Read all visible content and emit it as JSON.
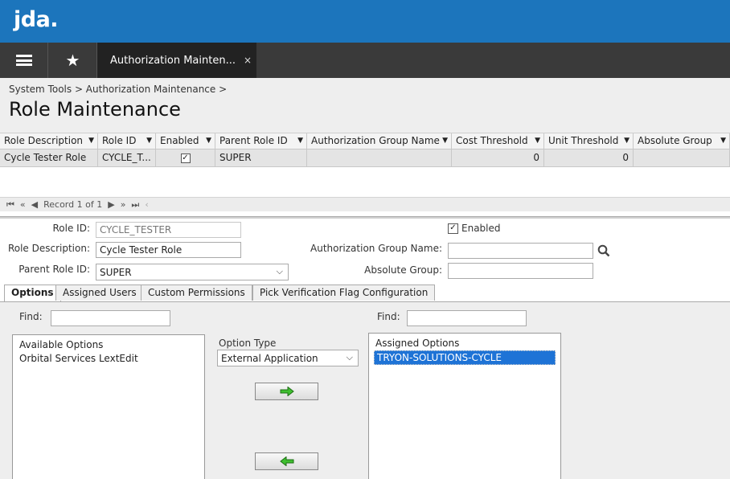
{
  "app": {
    "logo": "jda."
  },
  "nav": {
    "tab_label": "Authorization Mainten...",
    "tab_close": "×"
  },
  "breadcrumb": "System Tools > Authorization Maintenance >",
  "page_title": "Role Maintenance",
  "grid": {
    "columns": [
      "Role Description",
      "Role ID",
      "Enabled",
      "Parent Role ID",
      "Authorization Group Name",
      "Cost Threshold",
      "Unit Threshold",
      "Absolute Group"
    ],
    "row": {
      "role_description": "Cycle Tester Role",
      "role_id": "CYCLE_T...",
      "enabled_mark": "✓",
      "parent_role_id": "SUPER",
      "auth_group": "",
      "cost_threshold": "0",
      "unit_threshold": "0",
      "absolute_group": ""
    }
  },
  "pager": {
    "record_text": "Record 1 of 1"
  },
  "form": {
    "role_id_label": "Role ID:",
    "role_id_value": "CYCLE_TESTER",
    "role_desc_label": "Role Description:",
    "role_desc_value": "Cycle Tester Role",
    "parent_role_label": "Parent Role ID:",
    "parent_role_value": "SUPER",
    "enabled_label": "Enabled",
    "enabled_mark": "✓",
    "auth_group_label": "Authorization Group Name:",
    "auth_group_value": "",
    "absolute_group_label": "Absolute Group:",
    "absolute_group_value": ""
  },
  "tabs": [
    "Options",
    "Assigned Users",
    "Custom Permissions",
    "Pick Verification Flag Configuration"
  ],
  "options": {
    "find_label": "Find:",
    "available_header": "Available Options",
    "available_items": [
      "Orbital Services LextEdit"
    ],
    "option_type_label": "Option Type",
    "option_type_value": "External Application",
    "assigned_header": "Assigned Options",
    "assigned_items": [
      "TRYON-SOLUTIONS-CYCLE"
    ]
  }
}
